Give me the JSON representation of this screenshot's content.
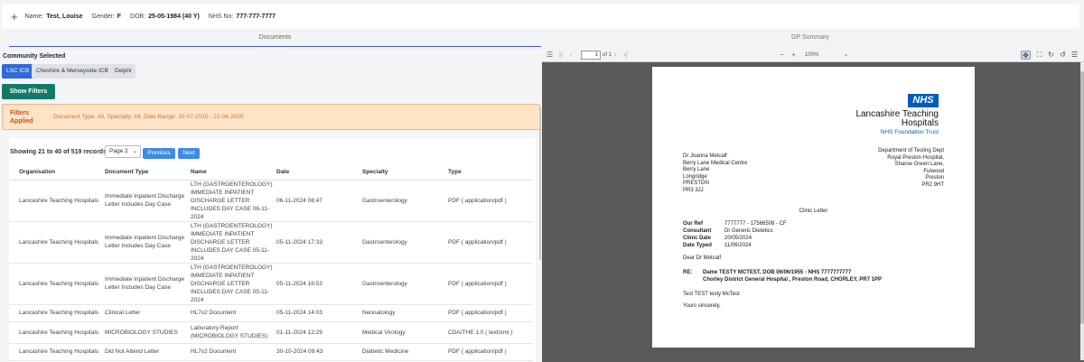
{
  "patient": {
    "name_label": "Name:",
    "name": "Test, Louise",
    "gender_label": "Gender:",
    "gender": "F",
    "dob_label": "DOB:",
    "dob": "25-05-1984 (40 Y)",
    "nhs_label": "NHS No:",
    "nhs": "777-777-7777"
  },
  "tabs": {
    "documents": "Documents",
    "gp_summary": "GP Summary"
  },
  "community": {
    "title": "Community Selected",
    "chips": [
      "LSC ICB",
      "Cheshire & Merseyside ICB",
      "Delphi"
    ]
  },
  "show_filters": "Show Filters",
  "filters": {
    "label": "Filters Applied",
    "text": "Document Type: All, Specialty: All, Date Range: 10-07-2010 - 22-04-2025"
  },
  "list": {
    "showing": "Showing 21 to 40 of 519 records",
    "page_select": "Page 2",
    "prev": "Previous",
    "next": "Next",
    "columns": [
      "Organisation",
      "Document Type",
      "Name",
      "Date",
      "Specialty",
      "Type"
    ],
    "rows": [
      [
        "Lancashire Teaching Hospitals",
        "Immediate Inpatient Discharge Letter Includes Day Case",
        "LTH (GASTROENTEROLOGY) IMMEDIATE INPATIENT DISCHARGE LETTER INCLUDES DAY CASE 06-11-2024",
        "06-11-2024 08:47",
        "Gastroenterology",
        "PDF ( application/pdf )"
      ],
      [
        "Lancashire Teaching Hospitals",
        "Immediate Inpatient Discharge Letter Includes Day Case",
        "LTH (GASTROENTEROLOGY) IMMEDIATE INPATIENT DISCHARGE LETTER INCLUDES DAY CASE 05-11-2024",
        "05-11-2024 17:33",
        "Gastroenterology",
        "PDF ( application/pdf )"
      ],
      [
        "Lancashire Teaching Hospitals",
        "Immediate Inpatient Discharge Letter Includes Day Case",
        "LTH (GASTROENTEROLOGY) IMMEDIATE INPATIENT DISCHARGE LETTER INCLUDES DAY CASE 05-11-2024",
        "05-11-2024 16:53",
        "Gastroenterology",
        "PDF ( application/pdf )"
      ],
      [
        "Lancashire Teaching Hospitals",
        "Clinical Letter",
        "HL7v2 Document",
        "05-11-2024 14:03",
        "Neonatology",
        "PDF ( application/pdf )"
      ],
      [
        "Lancashire Teaching Hospitals",
        "MICROBIOLOGY STUDIES",
        "Laboratory Report (MICROBIOLOGY STUDIES)",
        "01-11-2024 12:29",
        "Medical Virology",
        "CDA/THE 1.0 ( text/xml )"
      ],
      [
        "Lancashire Teaching Hospitals",
        "Did Not Attend Letter",
        "HL7v2 Document",
        "30-10-2024 09:43",
        "Diabetic Medicine",
        "PDF ( application/pdf )"
      ]
    ]
  },
  "viewer": {
    "page_number": "1",
    "of_pages": "of 1",
    "zoom": "100%"
  },
  "letter": {
    "logo": "NHS",
    "trust_line1": "Lancashire Teaching",
    "trust_line2": "Hospitals",
    "trust_sub": "NHS Foundation Trust",
    "to": [
      "Dr Joanna Metcalf",
      "Berry Lane Medical Centre",
      "Berry Lane",
      "Longridge",
      "PRESTON",
      "PR3 3JJ"
    ],
    "from": [
      "Department of Testing Dept",
      "Royal Preston Hospital,",
      "Sharoe Green Lane,",
      "Fulwood",
      "Preston",
      "PR2 9HT"
    ],
    "title": "Clinic Letter",
    "refs": [
      {
        "k": "Our Ref",
        "v": "7777777 - 17566508 - CF"
      },
      {
        "k": "Consultant",
        "v": "Dr Generic Dietetics"
      },
      {
        "k": "Clinic Date",
        "v": "20/05/2024"
      },
      {
        "k": "Date Typed",
        "v": "11/06/2024"
      }
    ],
    "dear": "Dear Dr Metcalf",
    "re_label": "RE:",
    "re_line1": "Dame TESTY MCTEST, DOB 06/06/1955 - NHS 7777777777",
    "re_line2": "Chorley District General Hospital , Preston Road, CHORLEY, PR7 1PP",
    "body": "Test TEST testy McTest",
    "sign": "Yours sincerely,"
  }
}
